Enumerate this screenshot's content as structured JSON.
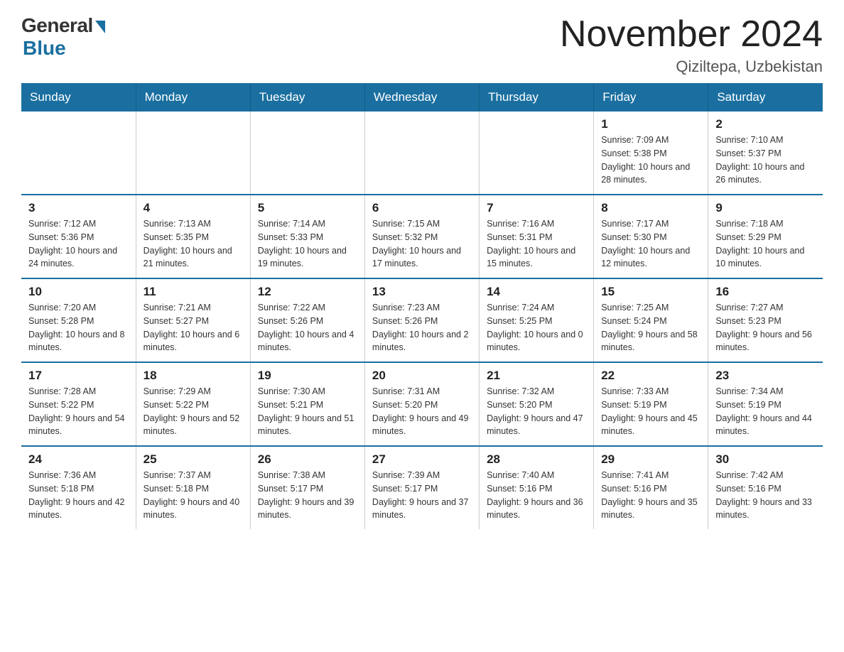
{
  "logo": {
    "general_text": "General",
    "blue_text": "Blue"
  },
  "title": "November 2024",
  "subtitle": "Qiziltepa, Uzbekistan",
  "weekdays": [
    "Sunday",
    "Monday",
    "Tuesday",
    "Wednesday",
    "Thursday",
    "Friday",
    "Saturday"
  ],
  "weeks": [
    [
      {
        "day": "",
        "info": ""
      },
      {
        "day": "",
        "info": ""
      },
      {
        "day": "",
        "info": ""
      },
      {
        "day": "",
        "info": ""
      },
      {
        "day": "",
        "info": ""
      },
      {
        "day": "1",
        "info": "Sunrise: 7:09 AM\nSunset: 5:38 PM\nDaylight: 10 hours and 28 minutes."
      },
      {
        "day": "2",
        "info": "Sunrise: 7:10 AM\nSunset: 5:37 PM\nDaylight: 10 hours and 26 minutes."
      }
    ],
    [
      {
        "day": "3",
        "info": "Sunrise: 7:12 AM\nSunset: 5:36 PM\nDaylight: 10 hours and 24 minutes."
      },
      {
        "day": "4",
        "info": "Sunrise: 7:13 AM\nSunset: 5:35 PM\nDaylight: 10 hours and 21 minutes."
      },
      {
        "day": "5",
        "info": "Sunrise: 7:14 AM\nSunset: 5:33 PM\nDaylight: 10 hours and 19 minutes."
      },
      {
        "day": "6",
        "info": "Sunrise: 7:15 AM\nSunset: 5:32 PM\nDaylight: 10 hours and 17 minutes."
      },
      {
        "day": "7",
        "info": "Sunrise: 7:16 AM\nSunset: 5:31 PM\nDaylight: 10 hours and 15 minutes."
      },
      {
        "day": "8",
        "info": "Sunrise: 7:17 AM\nSunset: 5:30 PM\nDaylight: 10 hours and 12 minutes."
      },
      {
        "day": "9",
        "info": "Sunrise: 7:18 AM\nSunset: 5:29 PM\nDaylight: 10 hours and 10 minutes."
      }
    ],
    [
      {
        "day": "10",
        "info": "Sunrise: 7:20 AM\nSunset: 5:28 PM\nDaylight: 10 hours and 8 minutes."
      },
      {
        "day": "11",
        "info": "Sunrise: 7:21 AM\nSunset: 5:27 PM\nDaylight: 10 hours and 6 minutes."
      },
      {
        "day": "12",
        "info": "Sunrise: 7:22 AM\nSunset: 5:26 PM\nDaylight: 10 hours and 4 minutes."
      },
      {
        "day": "13",
        "info": "Sunrise: 7:23 AM\nSunset: 5:26 PM\nDaylight: 10 hours and 2 minutes."
      },
      {
        "day": "14",
        "info": "Sunrise: 7:24 AM\nSunset: 5:25 PM\nDaylight: 10 hours and 0 minutes."
      },
      {
        "day": "15",
        "info": "Sunrise: 7:25 AM\nSunset: 5:24 PM\nDaylight: 9 hours and 58 minutes."
      },
      {
        "day": "16",
        "info": "Sunrise: 7:27 AM\nSunset: 5:23 PM\nDaylight: 9 hours and 56 minutes."
      }
    ],
    [
      {
        "day": "17",
        "info": "Sunrise: 7:28 AM\nSunset: 5:22 PM\nDaylight: 9 hours and 54 minutes."
      },
      {
        "day": "18",
        "info": "Sunrise: 7:29 AM\nSunset: 5:22 PM\nDaylight: 9 hours and 52 minutes."
      },
      {
        "day": "19",
        "info": "Sunrise: 7:30 AM\nSunset: 5:21 PM\nDaylight: 9 hours and 51 minutes."
      },
      {
        "day": "20",
        "info": "Sunrise: 7:31 AM\nSunset: 5:20 PM\nDaylight: 9 hours and 49 minutes."
      },
      {
        "day": "21",
        "info": "Sunrise: 7:32 AM\nSunset: 5:20 PM\nDaylight: 9 hours and 47 minutes."
      },
      {
        "day": "22",
        "info": "Sunrise: 7:33 AM\nSunset: 5:19 PM\nDaylight: 9 hours and 45 minutes."
      },
      {
        "day": "23",
        "info": "Sunrise: 7:34 AM\nSunset: 5:19 PM\nDaylight: 9 hours and 44 minutes."
      }
    ],
    [
      {
        "day": "24",
        "info": "Sunrise: 7:36 AM\nSunset: 5:18 PM\nDaylight: 9 hours and 42 minutes."
      },
      {
        "day": "25",
        "info": "Sunrise: 7:37 AM\nSunset: 5:18 PM\nDaylight: 9 hours and 40 minutes."
      },
      {
        "day": "26",
        "info": "Sunrise: 7:38 AM\nSunset: 5:17 PM\nDaylight: 9 hours and 39 minutes."
      },
      {
        "day": "27",
        "info": "Sunrise: 7:39 AM\nSunset: 5:17 PM\nDaylight: 9 hours and 37 minutes."
      },
      {
        "day": "28",
        "info": "Sunrise: 7:40 AM\nSunset: 5:16 PM\nDaylight: 9 hours and 36 minutes."
      },
      {
        "day": "29",
        "info": "Sunrise: 7:41 AM\nSunset: 5:16 PM\nDaylight: 9 hours and 35 minutes."
      },
      {
        "day": "30",
        "info": "Sunrise: 7:42 AM\nSunset: 5:16 PM\nDaylight: 9 hours and 33 minutes."
      }
    ]
  ]
}
